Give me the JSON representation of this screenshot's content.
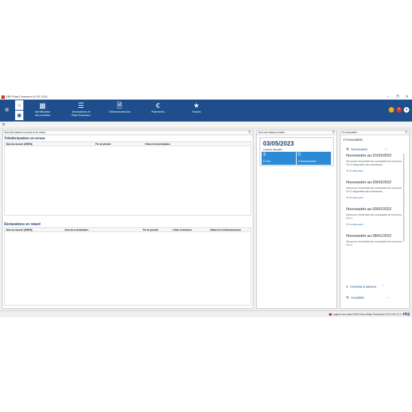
{
  "window": {
    "title": "EBP États Financiers ELITE 2023",
    "controls": {
      "minimize": "–",
      "maximize": "❐",
      "close": "✕"
    }
  },
  "ribbon": {
    "nav": [
      {
        "label_line1": "Identification",
        "label_line2": "des sociétés",
        "icon": "building-icon"
      },
      {
        "label_line1": "Déclarations et",
        "label_line2": "États financiers",
        "icon": "document-list-icon"
      },
      {
        "label_line1": "Télétransmissions",
        "label_line2": "",
        "icon": "file-icon"
      },
      {
        "label_line1": "Paiements",
        "label_line2": "",
        "icon": "euro-icon"
      },
      {
        "label_line1": "Favoris",
        "label_line2": "",
        "icon": "star-icon"
      }
    ],
    "status": {
      "warning": "!",
      "help": "?",
      "user": "●"
    },
    "colors": {
      "accent": "#1f4e8c"
    }
  },
  "left_panel": {
    "header": "Suivi des liasses en erreur et en retard",
    "error_section": {
      "title": "Télédéclaration en erreur",
      "columns": [
        "Nom du dossier (SIREN)",
        "Fin de période",
        "Nom de la déclaration"
      ]
    },
    "late_section": {
      "title": "Déclarations en retard",
      "columns": [
        "Nom du dossier (SIREN)",
        "Nom de la déclaration",
        "Fin de période",
        "Date d'échéance",
        "Statut de la télétransmission"
      ]
    }
  },
  "middle_panel": {
    "header": "Suivi des liasses à traiter",
    "date": "03/05/2023",
    "liasses_label": "Liasses fiscales",
    "tiles": [
      {
        "value": "3",
        "label": "À créer"
      },
      {
        "value": "0",
        "label": "À télétransmettre"
      }
    ],
    "colors": {
      "tile": "#2d8bd6"
    }
  },
  "right_panel": {
    "header": "Fil d'actualités",
    "tab": "Fil d'actualités",
    "nouveautes_label": "Nouveautés",
    "items": [
      {
        "title": "Nouveautés au 31/03/2022",
        "desc": "Découvrez l'ensemble des nouveautés de la version V21.3 disponibles dès maintenant.",
        "link": "Je découvre"
      },
      {
        "title": "Nouveautés au 03/03/2022",
        "desc": "Découvrez l'ensemble des nouveautés de la version V21.2 disponibles dès maintenant.",
        "link": "Je découvre"
      },
      {
        "title": "Nouveautés au 03/02/2022",
        "desc": "Découvrez l'ensemble des nouveautés de la version V21.1",
        "link": "Je découvre"
      },
      {
        "title": "Nouveautés au 08/01/2022",
        "desc": "Découvrez l'ensemble des nouveautés de la version V21.0",
        "link": ""
      }
    ],
    "conseils_label": "Conseils & astuces",
    "actualites_label": "Actualités"
  },
  "statusbar": {
    "text": "Logiciel non activé  EBP Démo États Financiers FR ELITE 21.3",
    "logo": "ebp"
  }
}
